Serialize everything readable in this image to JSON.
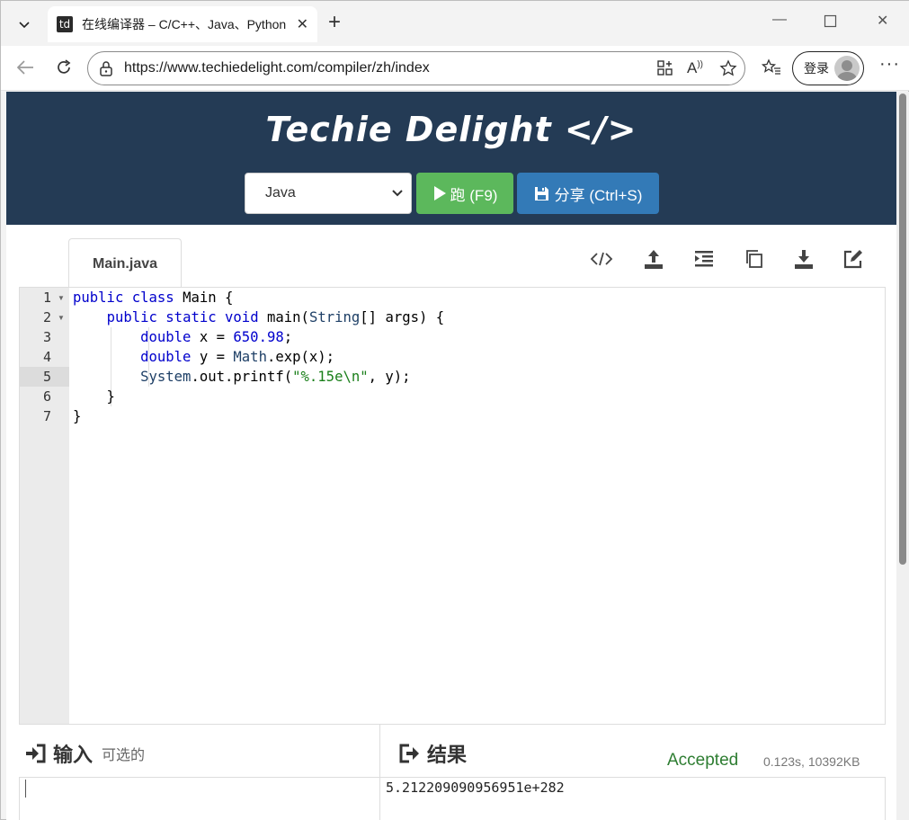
{
  "browser": {
    "tab_title": "在线编译器 – C/C++、Java、Python",
    "tab_favicon": "td",
    "url": "https://www.techiedelight.com/compiler/zh/index",
    "login_label": "登录"
  },
  "header": {
    "brand": "Techie Delight </>",
    "language_selected": "Java",
    "run_label": "跑 (F9)",
    "share_label": "分享 (Ctrl+S)"
  },
  "editor": {
    "file_tab": "Main.java",
    "line_numbers": [
      "1",
      "2",
      "3",
      "4",
      "5",
      "6",
      "7"
    ],
    "lines": [
      "public class Main {",
      "    public static void main(String[] args) {",
      "        double x = 650.98;",
      "        double y = Math.exp(x);",
      "        System.out.printf(\"%.15e\\n\", y);",
      "    }",
      "}"
    ],
    "active_line": 5
  },
  "io": {
    "input_title": "输入",
    "input_sub": "可选的",
    "result_title": "结果",
    "status": "Accepted",
    "stats": "0.123s, 10392KB",
    "output": "5.212209090956951e+282"
  },
  "colors": {
    "header_bg": "#243b55",
    "run_green": "#5cb85c",
    "share_blue": "#337ab7",
    "accepted_green": "#2e7d32"
  }
}
